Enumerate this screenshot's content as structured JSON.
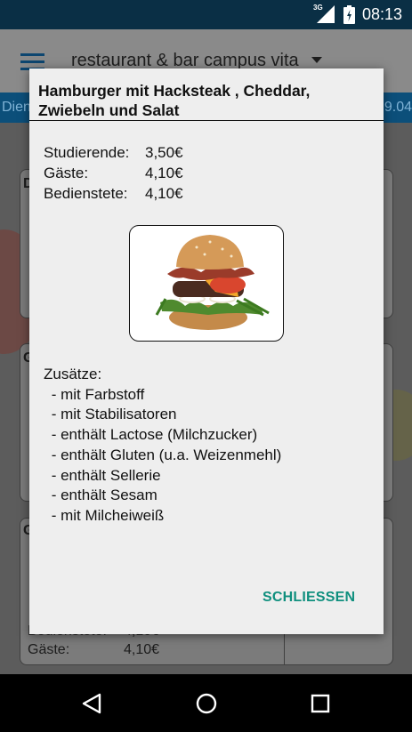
{
  "status_bar": {
    "network": "3G",
    "time": "08:13"
  },
  "app_bar": {
    "title": "restaurant & bar campus vita"
  },
  "date_strip": {
    "left_text": "Dien",
    "right_text": "9.04"
  },
  "background_cards": {
    "card1_letter": "D",
    "card2_letter": "G",
    "card3_letter": "G",
    "price_rows": [
      {
        "label": "Bedienstete:",
        "value": "4,10€"
      },
      {
        "label": "Gäste:",
        "value": "4,10€"
      }
    ]
  },
  "dialog": {
    "title": "Hamburger mit Hacksteak , Cheddar, Zwiebeln und Salat",
    "prices": [
      {
        "label": "Studierende:",
        "value": "3,50€"
      },
      {
        "label": "Gäste:",
        "value": "4,10€"
      },
      {
        "label": "Bedienstete:",
        "value": "4,10€"
      }
    ],
    "image_subject": "hamburger-photo",
    "addons_heading": "Zusätze:",
    "addons": [
      " - mit Farbstoff",
      " - mit Stabilisatoren",
      " - enthält Lactose (Milchzucker)",
      " - enthält Gluten (u.a. Weizenmehl)",
      " - enthält Sellerie",
      " - enthält Sesam",
      " - mit Milcheiweiß"
    ],
    "close_label": "SCHLIESSEN"
  },
  "nav_bar": {
    "icons": [
      "back-icon",
      "home-icon",
      "recents-icon"
    ]
  },
  "colors": {
    "status_bar": "#0a2f45",
    "date_strip": "#0c4f7a",
    "dialog_bg": "#eeeeee",
    "accent": "#0f8f7e"
  }
}
